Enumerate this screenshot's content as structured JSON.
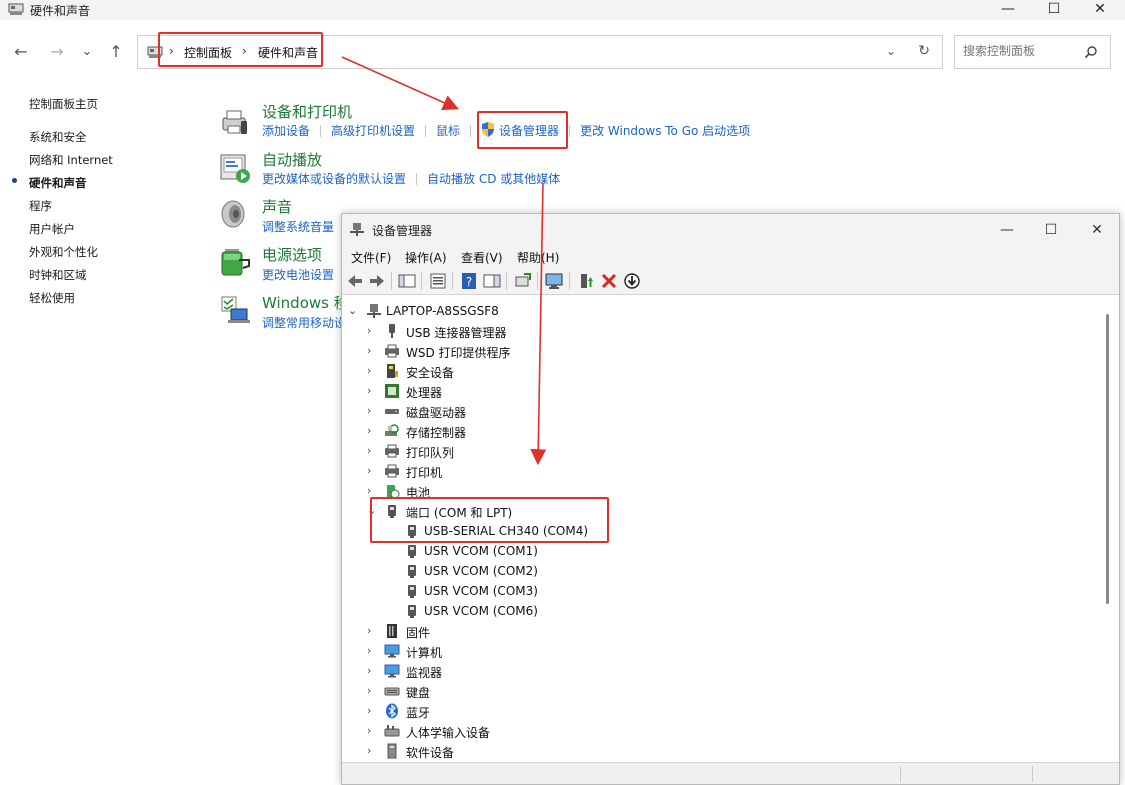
{
  "control_panel": {
    "window_title": "硬件和声音",
    "controls": {
      "minimize": "—",
      "maximize": "☐",
      "close": "✕"
    },
    "nav": {
      "back": "←",
      "forward": "→",
      "recent": "⌄",
      "up": "↑"
    },
    "breadcrumb": [
      "控制面板",
      "硬件和声音"
    ],
    "breadcrumb_sep": "›",
    "address_dropdown": "⌄",
    "refresh": "↻",
    "search_placeholder": "搜索控制面板",
    "left_nav": {
      "home": "控制面板主页",
      "items": [
        "系统和安全",
        "网络和 Internet",
        "硬件和声音",
        "程序",
        "用户帐户",
        "外观和个性化",
        "时钟和区域",
        "轻松使用"
      ],
      "current_index": 2
    },
    "categories": {
      "devices": {
        "title": "设备和打印机",
        "links": [
          "添加设备",
          "高级打印机设置",
          "鼠标",
          "设备管理器",
          "更改 Windows To Go 启动选项"
        ]
      },
      "autoplay": {
        "title": "自动播放",
        "links": [
          "更改媒体或设备的默认设置",
          "自动播放 CD 或其他媒体"
        ]
      },
      "sound": {
        "title": "声音",
        "links": [
          "调整系统音量"
        ]
      },
      "power": {
        "title": "电源选项",
        "links": [
          "更改电池设置"
        ]
      },
      "mobility": {
        "title": "Windows 移",
        "links": [
          "调整常用移动设"
        ]
      }
    }
  },
  "device_manager": {
    "window_title": "设备管理器",
    "controls": {
      "minimize": "—",
      "maximize": "☐",
      "close": "✕"
    },
    "menu": [
      "文件(F)",
      "操作(A)",
      "查看(V)",
      "帮助(H)"
    ],
    "tree": {
      "root": "LAPTOP-A8SSGSF8",
      "expand_collapsed": "›",
      "expand_open": "⌄",
      "nodes_before": [
        "USB 连接器管理器",
        "WSD 打印提供程序",
        "安全设备",
        "处理器",
        "磁盘驱动器",
        "存储控制器",
        "打印队列",
        "打印机",
        "电池"
      ],
      "ports": {
        "label": "端口 (COM 和 LPT)",
        "children": [
          "USB-SERIAL CH340 (COM4)",
          "USR VCOM (COM1)",
          "USR VCOM (COM2)",
          "USR VCOM (COM3)",
          "USR VCOM (COM6)"
        ]
      },
      "nodes_after": [
        "固件",
        "计算机",
        "监视器",
        "键盘",
        "蓝牙",
        "人体学输入设备",
        "软件设备"
      ]
    }
  },
  "colors": {
    "accent_link": "#1d63c5",
    "category_title": "#1e7a3a",
    "highlight": "#e0302a"
  }
}
